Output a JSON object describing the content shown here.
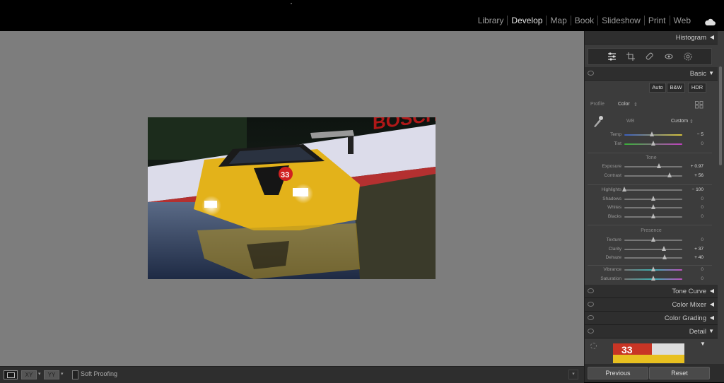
{
  "modules": [
    "Library",
    "Develop",
    "Map",
    "Book",
    "Slideshow",
    "Print",
    "Web"
  ],
  "active_module": "Develop",
  "histogram": {
    "title": "Histogram"
  },
  "basic": {
    "title": "Basic",
    "buttons": [
      "Auto",
      "B&W",
      "HDR"
    ],
    "profile_label": "Profile",
    "profile_value": "Color",
    "wb_label": "WB",
    "wb_value": "Custom",
    "tone_title": "Tone",
    "presence_title": "Presence"
  },
  "sliders_wb": [
    {
      "label": "Temp",
      "value": "− 5",
      "pos": 0.48,
      "grad": "linear-gradient(90deg,#3a5fbf,#d8c43a)"
    },
    {
      "label": "Tint",
      "value": "0",
      "pos": 0.5,
      "grad": "linear-gradient(90deg,#38b038,#c040c0)"
    }
  ],
  "sliders_tone": [
    {
      "label": "Exposure",
      "value": "+ 0.97",
      "pos": 0.6
    },
    {
      "label": "Contrast",
      "value": "+ 56",
      "pos": 0.78
    }
  ],
  "sliders_tone2": [
    {
      "label": "Highlights",
      "value": "− 100",
      "pos": 0.0
    },
    {
      "label": "Shadows",
      "value": "0",
      "pos": 0.5
    },
    {
      "label": "Whites",
      "value": "0",
      "pos": 0.5
    },
    {
      "label": "Blacks",
      "value": "0",
      "pos": 0.5
    }
  ],
  "sliders_presence": [
    {
      "label": "Texture",
      "value": "0",
      "pos": 0.5
    },
    {
      "label": "Clarity",
      "value": "+ 37",
      "pos": 0.68
    },
    {
      "label": "Dehaze",
      "value": "+ 40",
      "pos": 0.7
    }
  ],
  "sliders_presence2": [
    {
      "label": "Vibrance",
      "value": "0",
      "pos": 0.5,
      "grad": "linear-gradient(90deg,#777,#3ab0b0,#c050c0)"
    },
    {
      "label": "Saturation",
      "value": "0",
      "pos": 0.5,
      "grad": "linear-gradient(90deg,#777,#3ab0b0,#c050c0)"
    }
  ],
  "collapsed_panels": [
    "Tone Curve",
    "Color Mixer",
    "Color Grading"
  ],
  "detail": {
    "title": "Detail"
  },
  "toolbar": {
    "soft_proofing": "Soft Proofing",
    "compare": "XY",
    "survey": "YY"
  },
  "footer": {
    "previous": "Previous",
    "reset": "Reset"
  },
  "photo": {
    "banner_text": "BOSCH",
    "car_number": "33"
  }
}
